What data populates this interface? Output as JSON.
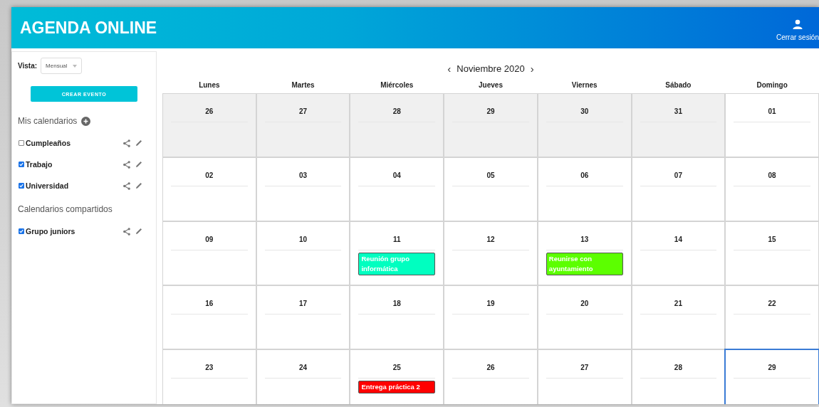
{
  "header": {
    "title": "AGENDA ONLINE",
    "logout": "Cerrar sesión"
  },
  "sidebar": {
    "view_label": "Vista:",
    "view_value": "Mensual",
    "create_button": "CREAR EVENTO",
    "sections": [
      {
        "title": "Mis calendarios",
        "add": true,
        "calendars": [
          {
            "name": "Cumpleaños",
            "checked": false
          },
          {
            "name": "Trabajo",
            "checked": true
          },
          {
            "name": "Universidad",
            "checked": true
          }
        ]
      },
      {
        "title": "Calendarios compartidos",
        "add": false,
        "calendars": [
          {
            "name": "Grupo juniors",
            "checked": true
          }
        ]
      }
    ]
  },
  "calendar": {
    "prev": "‹",
    "month": "Noviembre 2020",
    "next": "›",
    "weekdays": [
      "Lunes",
      "Martes",
      "Miércoles",
      "Jueves",
      "Viernes",
      "Sábado",
      "Domingo"
    ],
    "weeks": [
      [
        {
          "day": "26",
          "other_month": true
        },
        {
          "day": "27",
          "other_month": true
        },
        {
          "day": "28",
          "other_month": true
        },
        {
          "day": "29",
          "other_month": true
        },
        {
          "day": "30",
          "other_month": true
        },
        {
          "day": "31",
          "other_month": true
        },
        {
          "day": "01",
          "other_month": false
        }
      ],
      [
        {
          "day": "02",
          "other_month": false
        },
        {
          "day": "03",
          "other_month": false
        },
        {
          "day": "04",
          "other_month": false
        },
        {
          "day": "05",
          "other_month": false
        },
        {
          "day": "06",
          "other_month": false
        },
        {
          "day": "07",
          "other_month": false
        },
        {
          "day": "08",
          "other_month": false
        }
      ],
      [
        {
          "day": "09",
          "other_month": false
        },
        {
          "day": "10",
          "other_month": false
        },
        {
          "day": "11",
          "other_month": false,
          "events": [
            {
              "title": "Reunión grupo informática",
              "color": "#00ffc0"
            }
          ]
        },
        {
          "day": "12",
          "other_month": false
        },
        {
          "day": "13",
          "other_month": false,
          "events": [
            {
              "title": "Reunirse con ayuntamiento",
              "color": "#5cff00"
            }
          ]
        },
        {
          "day": "14",
          "other_month": false
        },
        {
          "day": "15",
          "other_month": false
        }
      ],
      [
        {
          "day": "16",
          "other_month": false
        },
        {
          "day": "17",
          "other_month": false
        },
        {
          "day": "18",
          "other_month": false
        },
        {
          "day": "19",
          "other_month": false
        },
        {
          "day": "20",
          "other_month": false
        },
        {
          "day": "21",
          "other_month": false
        },
        {
          "day": "22",
          "other_month": false
        }
      ],
      [
        {
          "day": "23",
          "other_month": false
        },
        {
          "day": "24",
          "other_month": false
        },
        {
          "day": "25",
          "other_month": false,
          "events": [
            {
              "title": "Entrega práctica 2",
              "color": "#ff0000"
            }
          ]
        },
        {
          "day": "26",
          "other_month": false
        },
        {
          "day": "27",
          "other_month": false
        },
        {
          "day": "28",
          "other_month": false
        },
        {
          "day": "29",
          "other_month": false,
          "today": true
        }
      ]
    ]
  }
}
